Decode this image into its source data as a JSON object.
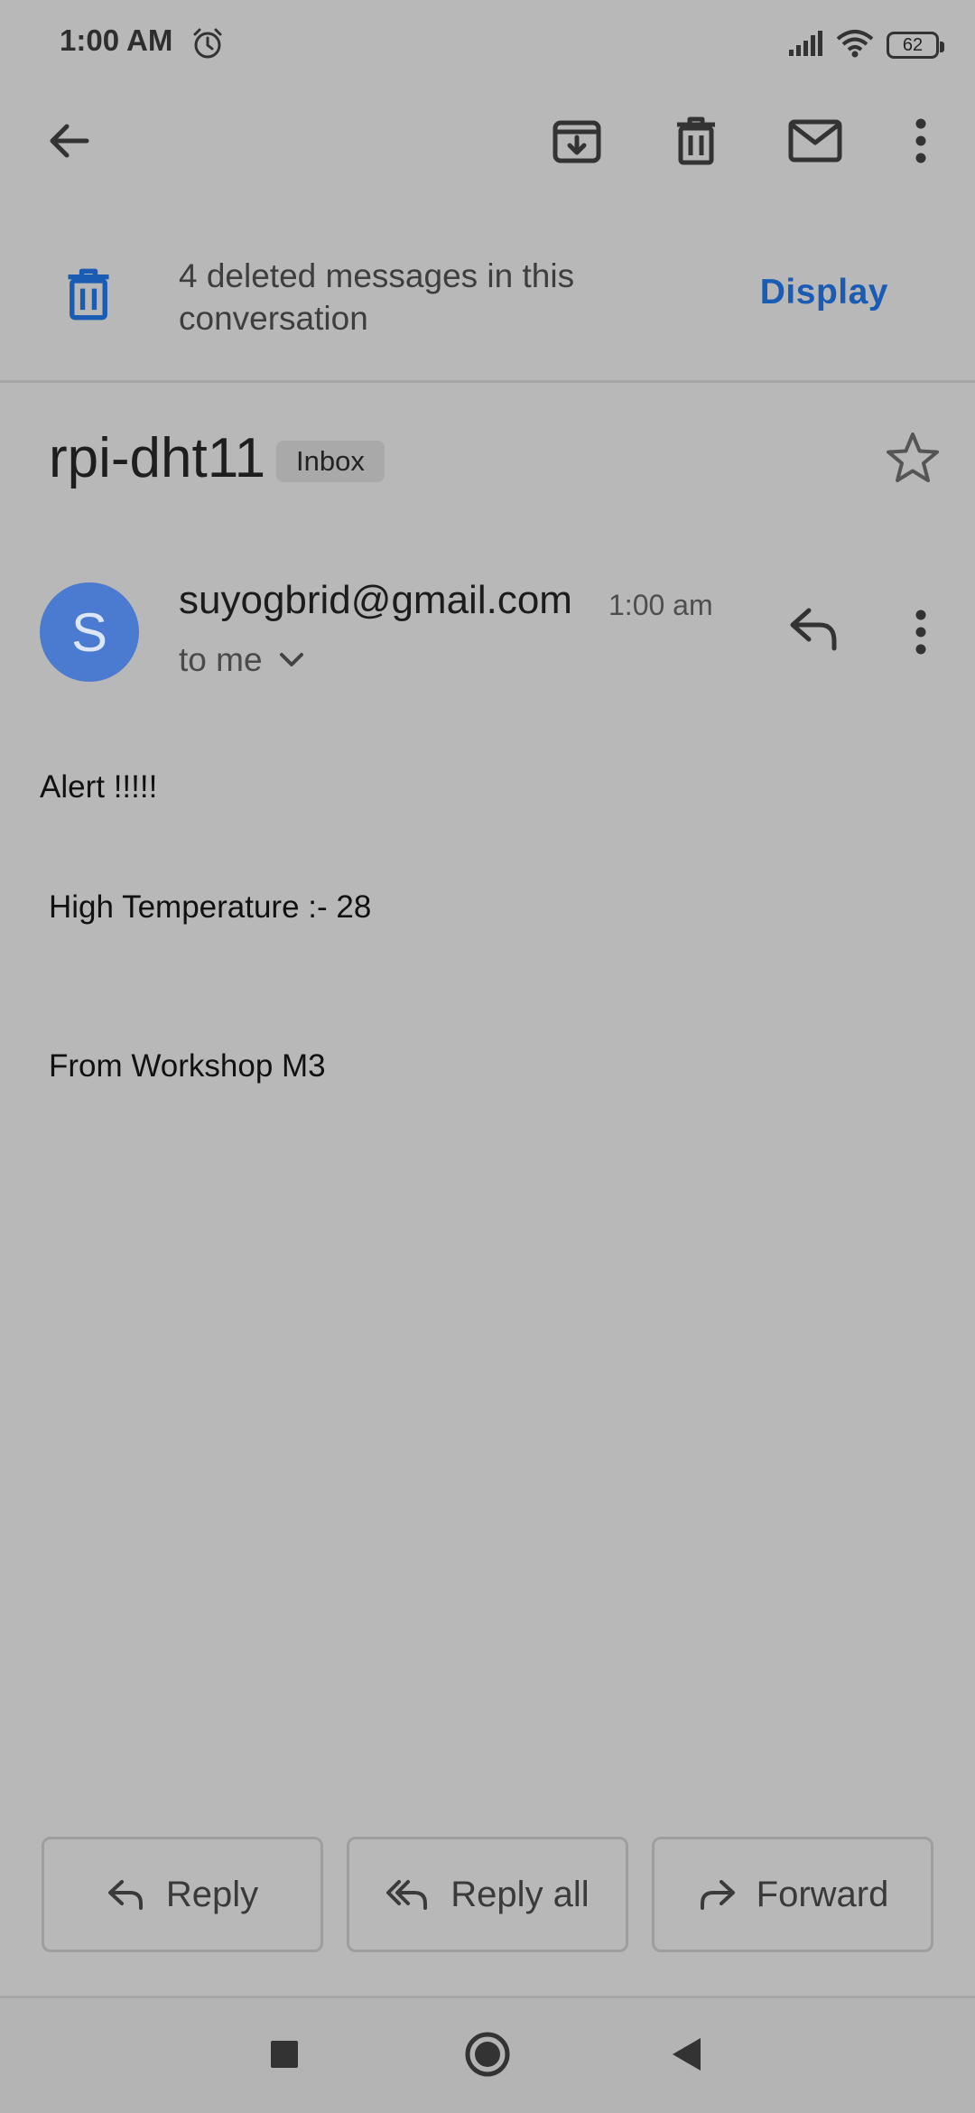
{
  "status_bar": {
    "time": "1:00 AM",
    "battery": "62",
    "icons": [
      "alarm-icon",
      "signal-icon",
      "wifi-icon",
      "battery-icon"
    ]
  },
  "toolbar": {
    "icons": [
      "back-arrow-icon",
      "archive-icon",
      "delete-icon",
      "mark-unread-icon",
      "more-vert-icon"
    ]
  },
  "deleted_banner": {
    "text": "4 deleted messages in this conversation",
    "action": "Display"
  },
  "subject": {
    "title": "rpi-dht11",
    "label": "Inbox"
  },
  "message": {
    "avatar_letter": "S",
    "sender": "suyogbrid@gmail.com",
    "time": "1:00 am",
    "recipient": "to me",
    "body": [
      "Alert !!!!!",
      "High Temperature :- 28",
      "From Workshop M3"
    ]
  },
  "actions": {
    "reply": "Reply",
    "reply_all": "Reply all",
    "forward": "Forward"
  },
  "colors": {
    "accent": "#1a5cb4",
    "avatar": "#4b7bd0",
    "background": "#b8b8b8"
  }
}
